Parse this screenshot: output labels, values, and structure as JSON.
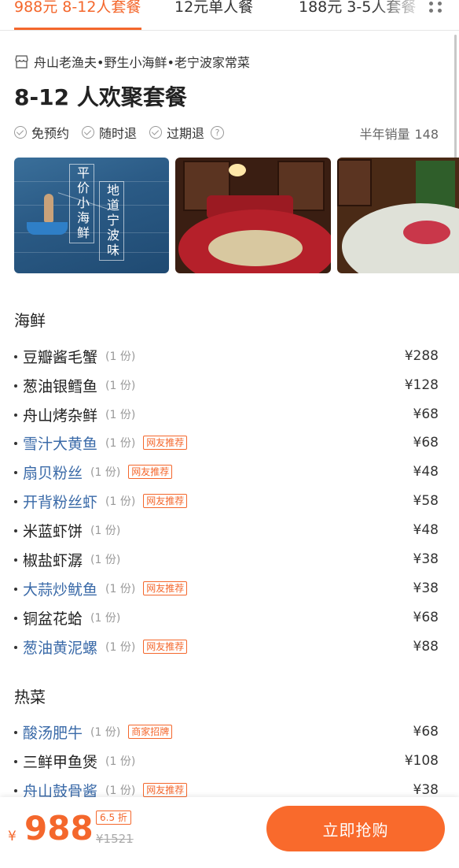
{
  "tabs": [
    {
      "label": "988元 8-12人套餐",
      "active": true
    },
    {
      "label": "12元单人餐",
      "active": false
    },
    {
      "label": "188元 3-5人套餐",
      "active": false
    }
  ],
  "shop": {
    "name": "舟山老渔夫•野生小海鲜•老宁波家常菜",
    "icon": "store-icon"
  },
  "title": "8-12 人欢聚套餐",
  "features": [
    "免预约",
    "随时退",
    "过期退"
  ],
  "sales": {
    "label": "半年销量",
    "count": "148"
  },
  "image1": {
    "text_left": "平价小海鲜",
    "text_right": "地道宁波味"
  },
  "sections": [
    {
      "title": "海鲜",
      "items": [
        {
          "name": "豆瓣酱毛蟹",
          "qty": "(1 份)",
          "tag": "",
          "price": "¥288"
        },
        {
          "name": "葱油银鳕鱼",
          "qty": "(1 份)",
          "tag": "",
          "price": "¥128"
        },
        {
          "name": "舟山烤杂鲜",
          "qty": "(1 份)",
          "tag": "",
          "price": "¥68"
        },
        {
          "name": "雪汁大黄鱼",
          "qty": "(1 份)",
          "tag": "网友推荐",
          "price": "¥68"
        },
        {
          "name": "扇贝粉丝",
          "qty": "(1 份)",
          "tag": "网友推荐",
          "price": "¥48"
        },
        {
          "name": "开背粉丝虾",
          "qty": "(1 份)",
          "tag": "网友推荐",
          "price": "¥58"
        },
        {
          "name": "米蓝虾饼",
          "qty": "(1 份)",
          "tag": "",
          "price": "¥48"
        },
        {
          "name": "椒盐虾潺",
          "qty": "(1 份)",
          "tag": "",
          "price": "¥38"
        },
        {
          "name": "大蒜炒鱿鱼",
          "qty": "(1 份)",
          "tag": "网友推荐",
          "price": "¥38"
        },
        {
          "name": "铜盆花蛤",
          "qty": "(1 份)",
          "tag": "",
          "price": "¥68"
        },
        {
          "name": "葱油黄泥螺",
          "qty": "(1 份)",
          "tag": "网友推荐",
          "price": "¥88"
        }
      ]
    },
    {
      "title": "热菜",
      "items": [
        {
          "name": "酸汤肥牛",
          "qty": "(1 份)",
          "tag": "商家招牌",
          "price": "¥68"
        },
        {
          "name": "三鲜甲鱼煲",
          "qty": "(1 份)",
          "tag": "",
          "price": "¥108"
        },
        {
          "name": "舟山鼓骨酱",
          "qty": "(1 份)",
          "tag": "网友推荐",
          "price": "¥38"
        }
      ]
    }
  ],
  "bottom": {
    "currency": "¥",
    "price": "988",
    "discount": "6.5 折",
    "original": "¥1521",
    "buy_label": "立即抢购"
  },
  "colors": {
    "accent": "#f4672c",
    "link": "#3a6aa8"
  }
}
